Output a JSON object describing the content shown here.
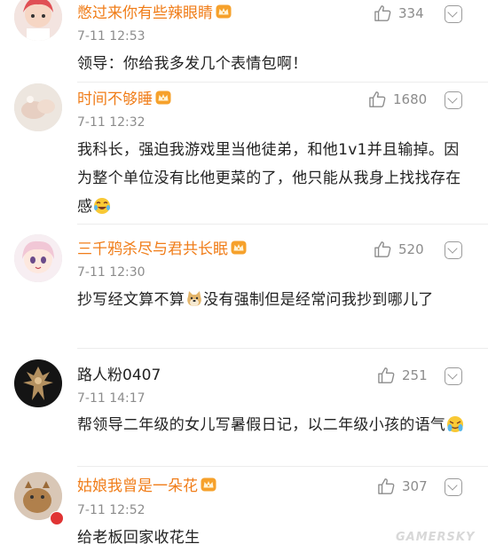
{
  "comments": [
    {
      "username": "憋过来你有些辣眼睛",
      "time": "7-11 12:53",
      "likes": "334",
      "text": "领导：你给我多发几个表情包啊！"
    },
    {
      "username": "时间不够睡",
      "time": "7-11 12:32",
      "likes": "1680",
      "text": "我科长，强迫我游戏里当他徒弟，和他1v1并且输掉。因为整个单位没有比他更菜的了，他只能从我身上找找存在感"
    },
    {
      "username": "三千鸦杀尽与君共长眠",
      "time": "7-11 12:30",
      "likes": "520",
      "text_a": "抄写经文算不算",
      "text_b": "没有强制但是经常问我抄到哪儿了"
    },
    {
      "username": "路人粉0407",
      "time": "7-11 14:17",
      "likes": "251",
      "text": "帮领导二年级的女儿写暑假日记，以二年级小孩的语气"
    },
    {
      "username": "姑娘我曾是一朵花",
      "time": "7-11 12:52",
      "likes": "307",
      "text": "给老板回家收花生"
    }
  ],
  "watermark": "GAMERSKY",
  "icons": {
    "like": "thumbs-up-icon",
    "menu": "chevron-down-icon",
    "vip": "crown-icon"
  },
  "colors": {
    "vip_name": "#f07d19",
    "normal_name": "#222222",
    "meta": "#8c8c8c"
  }
}
